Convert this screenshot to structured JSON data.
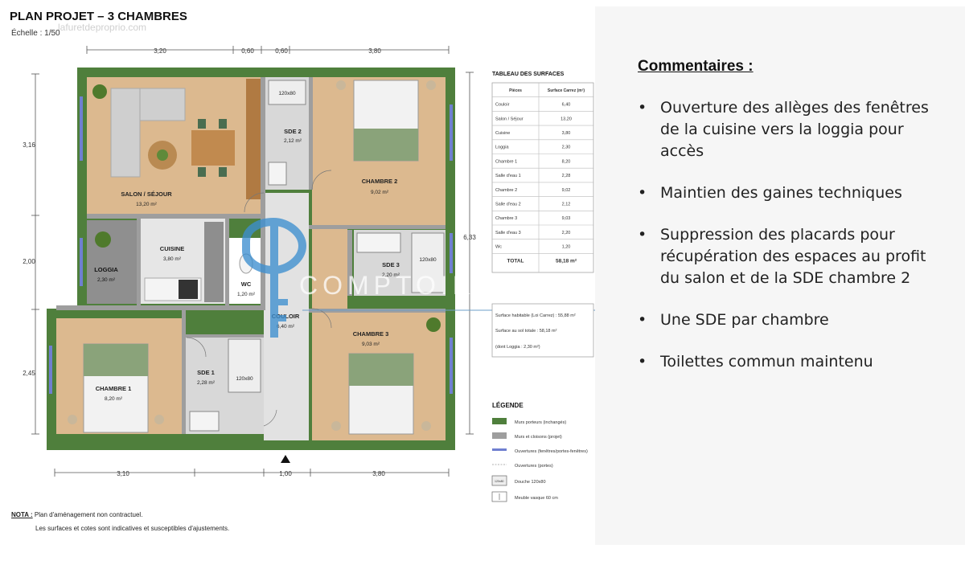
{
  "header": {
    "title": "PLAN PROJET – 3 CHAMBRES",
    "scale": "Échelle : 1/50",
    "watermark_url": "lafuretdeproprio.com"
  },
  "dimensions": {
    "top": [
      "3,20",
      "0,60",
      "0,60",
      "3,80"
    ],
    "bottom": [
      "3,10",
      "1,00",
      "3,80"
    ],
    "left": [
      "3,16",
      "2,00",
      "2,45"
    ],
    "right": "6,33"
  },
  "rooms": {
    "salon": {
      "name": "SALON / SÉJOUR",
      "area": "13,20 m²"
    },
    "cuisine": {
      "name": "CUISINE",
      "area": "3,80 m²"
    },
    "loggia": {
      "name": "LOGGIA",
      "area": "2,30 m²"
    },
    "wc": {
      "name": "WC",
      "area": "1,20 m²"
    },
    "sde2": {
      "name": "SDE 2",
      "area": "2,12 m²",
      "shower": "120x80"
    },
    "chambre2": {
      "name": "CHAMBRE 2",
      "area": "9,02 m²"
    },
    "sde3": {
      "name": "SDE 3",
      "area": "2,20 m²",
      "shower": "120x80"
    },
    "couloir": {
      "name": "COULOIR",
      "area": "6,40 m²"
    },
    "chambre3": {
      "name": "CHAMBRE 3",
      "area": "9,03 m²"
    },
    "chambre1": {
      "name": "CHAMBRE 1",
      "area": "8,20 m²"
    },
    "sde1": {
      "name": "SDE 1",
      "area": "2,28 m²",
      "shower": "120x80"
    }
  },
  "watermark_brand": "COMPTOIR IMMO",
  "surfaces_table": {
    "title": "TABLEAU DES SURFACES",
    "headers": [
      "Pièces",
      "Surface Carrez (m²)"
    ],
    "rows": [
      [
        "Couloir",
        "6,40"
      ],
      [
        "Salon / Séjour",
        "13,20"
      ],
      [
        "Cuisine",
        "3,80"
      ],
      [
        "Loggia",
        "2,30"
      ],
      [
        "Chambre 1",
        "8,20"
      ],
      [
        "Salle d'eau 1",
        "2,28"
      ],
      [
        "Chambre 2",
        "9,02"
      ],
      [
        "Salle d'eau 2",
        "2,12"
      ],
      [
        "Chambre 3",
        "9,03"
      ],
      [
        "Salle d'eau 3",
        "2,20"
      ],
      [
        "Wc",
        "1,20"
      ]
    ],
    "total": [
      "TOTAL",
      "58,18 m²"
    ]
  },
  "summary_box": {
    "habitable": "Surface habitable (Loi Carrez) : 55,88 m²",
    "au_sol": "Surface au sol totale : 58,18 m²",
    "loggia": "(dont Loggia : 2,30 m²)"
  },
  "legend": {
    "title": "LÉGENDE",
    "items": [
      "Murs porteurs (inchangés)",
      "Murs et cloisons (projet)",
      "Ouvertures (fenêtres/portes-fenêtres)",
      "Ouvertures (portes)",
      "Douche 120x80",
      "Meuble vasque 60 cm"
    ],
    "shower_icon_label": "120x80"
  },
  "notes": {
    "label": "NOTA :",
    "line1": "Plan d'aménagement non contractuel.",
    "line2": "Les surfaces et cotes sont indicatives et susceptibles d'ajustements."
  },
  "comments": {
    "title": "Commentaires :",
    "items": [
      "Ouverture des allèges des fenêtres de la cuisine vers la loggia pour accès",
      "Maintien des gaines techniques",
      "Suppression des placards pour récupération des espaces au profit du salon et de la SDE chambre 2",
      "Une SDE par chambre",
      "Toilettes commun maintenu"
    ]
  },
  "colors": {
    "load_wall": "#4f7f3c",
    "partition": "#9e9e9e",
    "wood_floor": "#dcb98f",
    "tile_floor": "#d7d7d7",
    "window": "#6f7fd0",
    "bed": "#8aa37a"
  }
}
